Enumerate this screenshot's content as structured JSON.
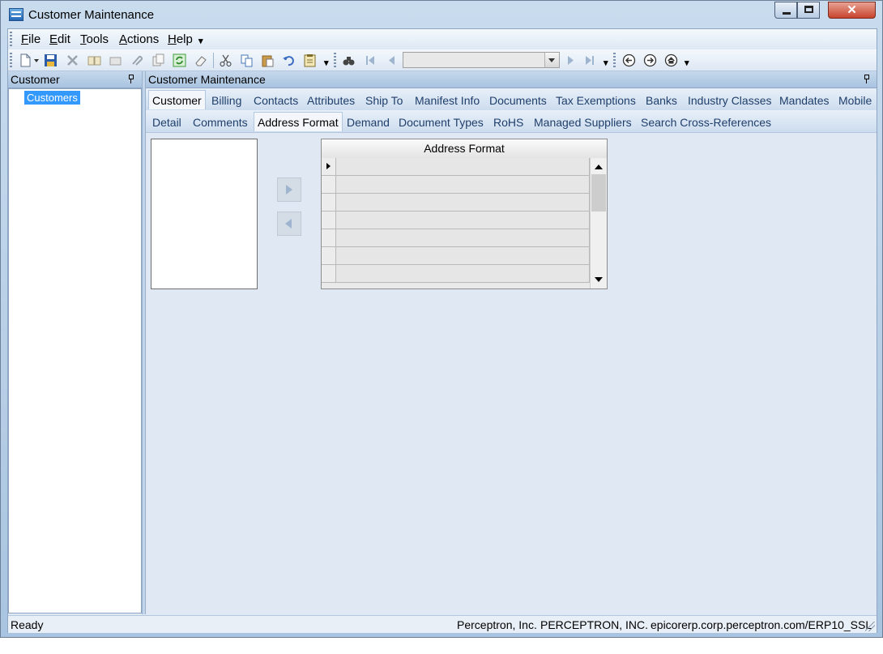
{
  "window": {
    "title": "Customer Maintenance",
    "close_glyph": "✕"
  },
  "menu": [
    {
      "key": "F",
      "rest": "ile",
      "name": "menu-file"
    },
    {
      "key": "E",
      "rest": "dit",
      "name": "menu-edit"
    },
    {
      "key": "T",
      "rest": "ools",
      "name": "menu-tools"
    },
    {
      "key": "A",
      "rest": "ctions",
      "name": "menu-actions"
    },
    {
      "key": "H",
      "rest": "elp",
      "name": "menu-help"
    }
  ],
  "more_glyph": "▾",
  "toolbar": {
    "icons": [
      "new-icon",
      "save-icon",
      "delete-icon",
      "open-icon",
      "clear-icon",
      "attach-icon",
      "copy-record-icon",
      "refresh-icon",
      "eraser-icon",
      "cut-icon",
      "copy-icon",
      "paste-icon",
      "undo-icon",
      "clipboard-icon",
      "search-icon",
      "first-icon",
      "prev-icon",
      "next-icon",
      "last-icon",
      "back-icon",
      "forward-icon",
      "home-icon"
    ],
    "navigator_value": ""
  },
  "left_panel": {
    "title": "Customer",
    "tree_item": "Customers"
  },
  "right_panel": {
    "title": "Customer Maintenance"
  },
  "tabs_primary": [
    "Customer",
    "Billing",
    "Contacts",
    "Attributes",
    "Ship To",
    "Manifest Info",
    "Documents",
    "Tax Exemptions",
    "Banks",
    "Industry Classes",
    "Mandates",
    "Mobile"
  ],
  "tabs_primary_active": "Customer",
  "tabs_secondary": [
    "Detail",
    "Comments",
    "Address Format",
    "Demand",
    "Document Types",
    "RoHS",
    "Managed Suppliers",
    "Search Cross-References"
  ],
  "tabs_secondary_active": "Address Format",
  "grid": {
    "header": "Address Format",
    "row_count": 7
  },
  "status": {
    "left": "Ready",
    "company": "Perceptron, Inc.",
    "company_id": "PERCEPTRON, INC.",
    "server": "epicorerp.corp.perceptron.com/ERP10_SSL"
  },
  "colors": {
    "selection": "#3399ff",
    "panel_header": "#b8cfe7",
    "content_bg": "#dfe8f3"
  }
}
